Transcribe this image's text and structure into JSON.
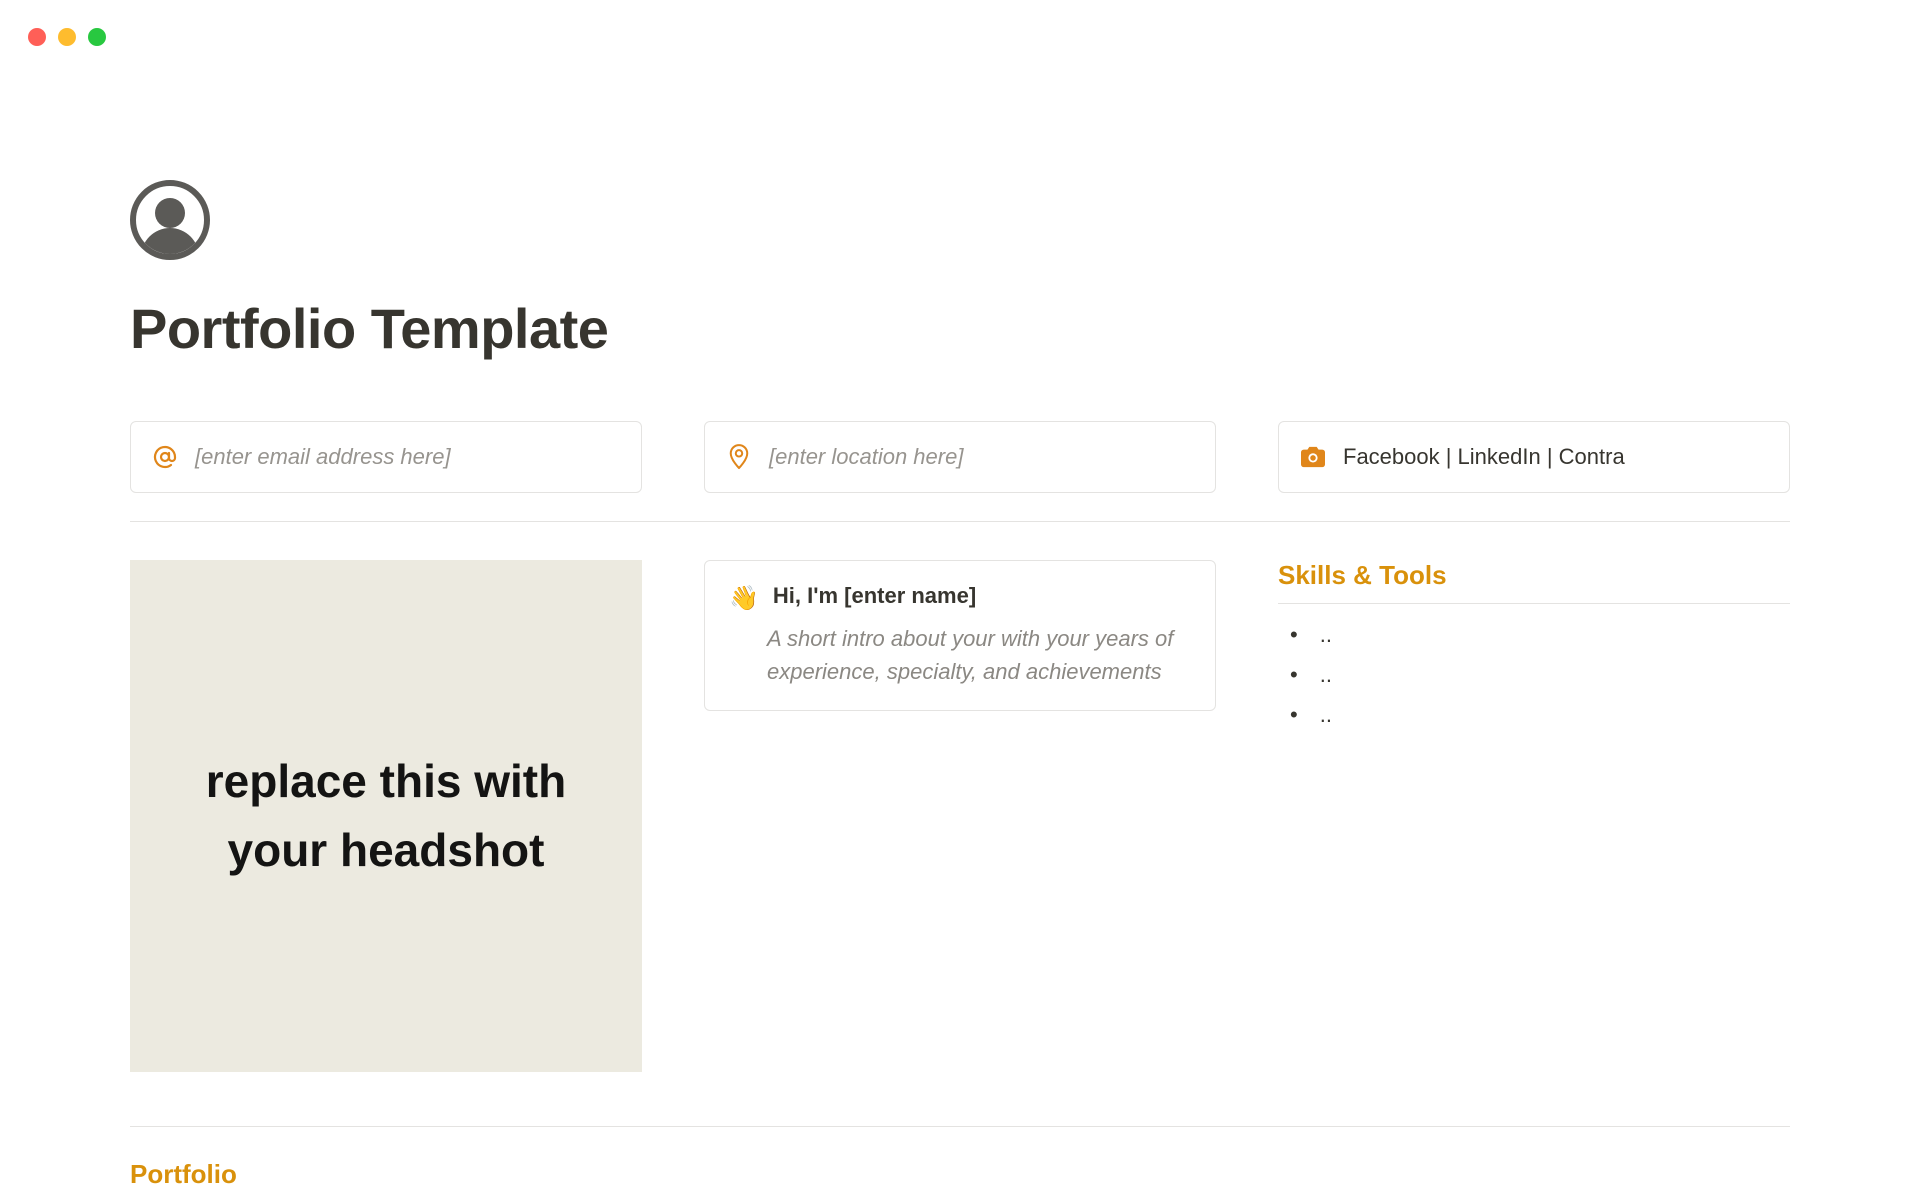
{
  "page_title": "Portfolio Template",
  "info_cards": {
    "email": {
      "placeholder": "[enter email address here]"
    },
    "location": {
      "placeholder": "[enter location here]"
    },
    "social": {
      "text": "Facebook | LinkedIn | Contra"
    }
  },
  "headshot": {
    "text": "replace this with your headshot"
  },
  "intro": {
    "wave": "👋",
    "title": "Hi, I'm [enter name]",
    "body": "A short intro about your with your years of experience, specialty, and achievements"
  },
  "skills": {
    "heading": "Skills & Tools",
    "items": [
      "..",
      "..",
      ".."
    ]
  },
  "sections": {
    "portfolio_heading": "Portfolio"
  },
  "colors": {
    "accent": "#d9910b",
    "icon_orange": "#e0861a"
  }
}
